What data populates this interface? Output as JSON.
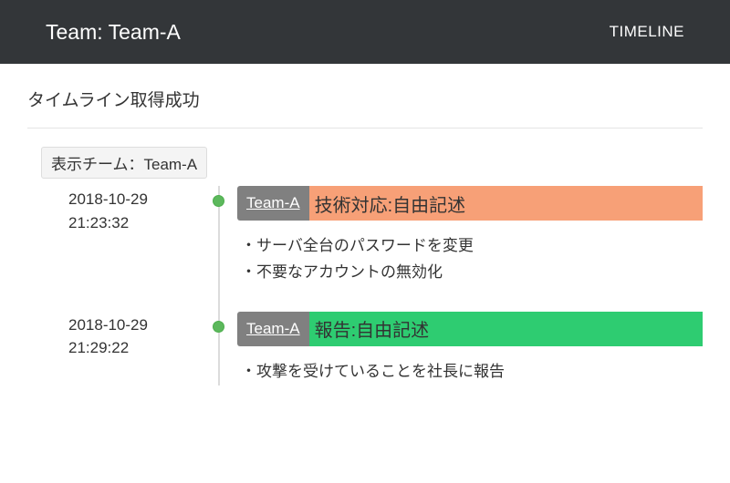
{
  "header": {
    "title": "Team: Team-A",
    "nav": "TIMELINE"
  },
  "status": "タイムライン取得成功",
  "team_filter": "表示チーム：Team-A",
  "entries": [
    {
      "date": "2018-10-29",
      "time": "21:23:32",
      "team": "Team-A",
      "title": "技術対応:自由記述",
      "color": "orange",
      "details": [
        "・サーバ全台のパスワードを変更",
        "・不要なアカウントの無効化"
      ]
    },
    {
      "date": "2018-10-29",
      "time": "21:29:22",
      "team": "Team-A",
      "title": "報告:自由記述",
      "color": "green",
      "details": [
        "・攻撃を受けていることを社長に報告"
      ]
    }
  ]
}
